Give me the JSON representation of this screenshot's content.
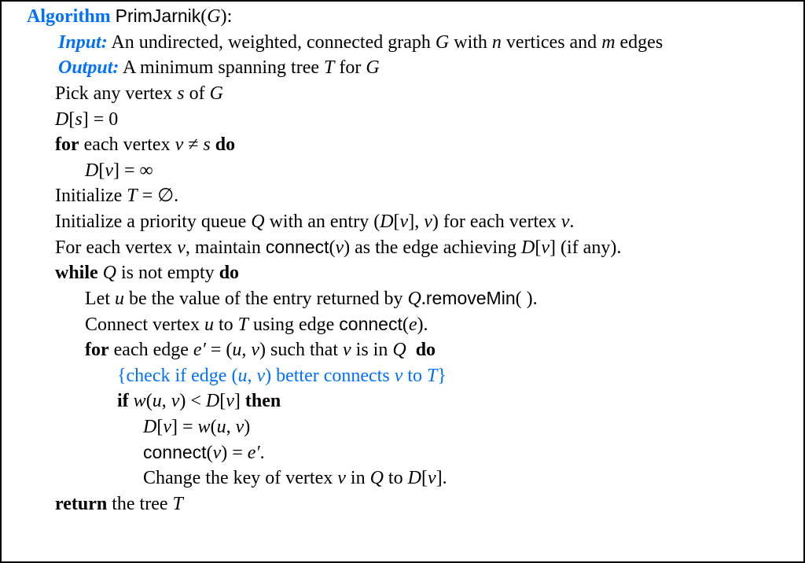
{
  "algorithm_keyword": "Algorithm",
  "algorithm_name": "PrimJarnik",
  "algorithm_arg": "G",
  "input_keyword": "Input:",
  "input_desc_1": " An undirected, weighted, connected graph ",
  "input_desc_g": "G",
  "input_desc_2": " with ",
  "input_desc_n": "n",
  "input_desc_3": " vertices and ",
  "input_desc_m": "m",
  "input_desc_4": " edges",
  "output_keyword": "Output:",
  "output_desc_1": " A minimum spanning tree ",
  "output_desc_t": "T",
  "output_desc_2": " for ",
  "output_desc_g": "G",
  "l1_a": "Pick any vertex ",
  "l1_s": "s",
  "l1_b": " of ",
  "l1_g": "G",
  "l2_D": "D",
  "l2_br_l": "[",
  "l2_s": "s",
  "l2_br_r": "]",
  "l2_eq": " = 0",
  "l3_for": "for",
  "l3_a": " each vertex ",
  "l3_v": "v",
  "l3_ne": " ≠ ",
  "l3_s": "s",
  "l3_do": " do",
  "l4_D": "D",
  "l4_br_l": "[",
  "l4_v": "v",
  "l4_br_r": "]",
  "l4_eq": " = ∞",
  "l5_a": "Initialize ",
  "l5_T": "T",
  "l5_b": " = ∅.",
  "l6_a": "Initialize a priority queue ",
  "l6_Q": "Q",
  "l6_b": " with an entry (",
  "l6_D": "D",
  "l6_br_l": "[",
  "l6_v1": "v",
  "l6_br_r": "]",
  "l6_c": ", ",
  "l6_v2": "v",
  "l6_d": ") for each vertex ",
  "l6_v3": "v",
  "l6_e": ".",
  "l7_a": "For each vertex ",
  "l7_v": "v",
  "l7_b": ", maintain ",
  "l7_conn": "connect",
  "l7_c": "(",
  "l7_v2": "v",
  "l7_d": ") as the edge achieving ",
  "l7_D": "D",
  "l7_br_l": "[",
  "l7_v3": "v",
  "l7_br_r": "]",
  "l7_e": " (if any).",
  "l8_while": "while",
  "l8_Q": " Q",
  "l8_a": " is not empty ",
  "l8_do": "do",
  "l9_a": "Let ",
  "l9_u": "u",
  "l9_b": " be the value of the entry returned by ",
  "l9_Q": "Q",
  "l9_c": ".",
  "l9_rm": "removeMin",
  "l9_d": "( ).",
  "l10_a": "Connect vertex ",
  "l10_u": "u",
  "l10_b": " to ",
  "l10_T": "T",
  "l10_c": " using edge ",
  "l10_conn": "connect",
  "l10_d": "(",
  "l10_e": "e",
  "l10_f": ").",
  "l11_for": "for",
  "l11_a": " each edge ",
  "l11_ep": "e′",
  "l11_b": " = (",
  "l11_u": "u",
  "l11_c": ", ",
  "l11_v": "v",
  "l11_d": ") such that ",
  "l11_v2": "v",
  "l11_e": " is in ",
  "l11_Q": "Q",
  "l11_do": "  do",
  "l12_a": "{check if edge (",
  "l12_u": "u",
  "l12_b": ", ",
  "l12_v": "v",
  "l12_c": ") better connects ",
  "l12_v2": "v",
  "l12_d": " to ",
  "l12_T": "T",
  "l12_e": "}",
  "l13_if": "if",
  "l13_w": " w",
  "l13_a": "(",
  "l13_u": "u",
  "l13_b": ", ",
  "l13_v": "v",
  "l13_c": ") < ",
  "l13_D": "D",
  "l13_br_l": "[",
  "l13_v2": "v",
  "l13_br_r": "]",
  "l13_then": " then",
  "l14_D": "D",
  "l14_br_l": "[",
  "l14_v": "v",
  "l14_br_r": "]",
  "l14_a": " = ",
  "l14_w": "w",
  "l14_b": "(",
  "l14_u": "u",
  "l14_c": ", ",
  "l14_v2": "v",
  "l14_d": ")",
  "l15_conn": "connect",
  "l15_a": "(",
  "l15_v": "v",
  "l15_b": ") = ",
  "l15_ep": "e′",
  "l15_c": ".",
  "l16_a": "Change the key of vertex ",
  "l16_v": "v",
  "l16_b": " in ",
  "l16_Q": "Q",
  "l16_c": " to ",
  "l16_D": "D",
  "l16_br_l": "[",
  "l16_v2": "v",
  "l16_br_r": "]",
  "l16_d": ".",
  "l17_ret": "return",
  "l17_a": " the tree ",
  "l17_T": "T"
}
